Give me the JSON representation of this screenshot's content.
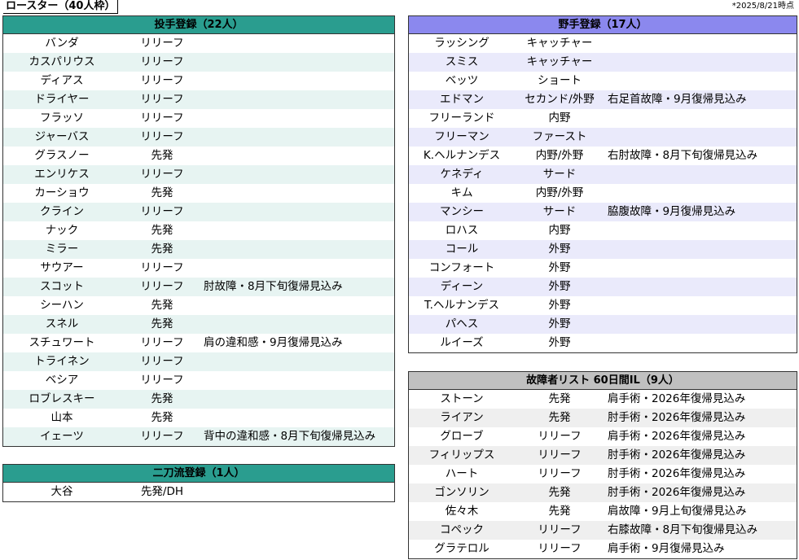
{
  "title": "ロースター（40人枠）",
  "datestamp": "*2025/8/21時点",
  "pitchers": {
    "header": "投手登録（22人）",
    "rows": [
      {
        "name": "バンダ",
        "pos": "リリーフ",
        "note": ""
      },
      {
        "name": "カスパリウス",
        "pos": "リリーフ",
        "note": ""
      },
      {
        "name": "ディアス",
        "pos": "リリーフ",
        "note": ""
      },
      {
        "name": "ドライヤー",
        "pos": "リリーフ",
        "note": ""
      },
      {
        "name": "フラッソ",
        "pos": "リリーフ",
        "note": ""
      },
      {
        "name": "ジャーバス",
        "pos": "リリーフ",
        "note": ""
      },
      {
        "name": "グラスノー",
        "pos": "先発",
        "note": ""
      },
      {
        "name": "エンリケス",
        "pos": "リリーフ",
        "note": ""
      },
      {
        "name": "カーショウ",
        "pos": "先発",
        "note": ""
      },
      {
        "name": "クライン",
        "pos": "リリーフ",
        "note": ""
      },
      {
        "name": "ナック",
        "pos": "先発",
        "note": ""
      },
      {
        "name": "ミラー",
        "pos": "先発",
        "note": ""
      },
      {
        "name": "サウアー",
        "pos": "リリーフ",
        "note": ""
      },
      {
        "name": "スコット",
        "pos": "リリーフ",
        "note": "肘故障・8月下旬復帰見込み"
      },
      {
        "name": "シーハン",
        "pos": "先発",
        "note": ""
      },
      {
        "name": "スネル",
        "pos": "先発",
        "note": ""
      },
      {
        "name": "スチュワート",
        "pos": "リリーフ",
        "note": "肩の違和感・9月復帰見込み"
      },
      {
        "name": "トライネン",
        "pos": "リリーフ",
        "note": ""
      },
      {
        "name": "ベシア",
        "pos": "リリーフ",
        "note": ""
      },
      {
        "name": "ロブレスキー",
        "pos": "先発",
        "note": ""
      },
      {
        "name": "山本",
        "pos": "先発",
        "note": ""
      },
      {
        "name": "イェーツ",
        "pos": "リリーフ",
        "note": "背中の違和感・8月下旬復帰見込み"
      }
    ]
  },
  "twoway": {
    "header": "二刀流登録（1人）",
    "rows": [
      {
        "name": "大谷",
        "pos": "先発/DH",
        "note": ""
      }
    ]
  },
  "fielders": {
    "header": "野手登録（17人）",
    "rows": [
      {
        "name": "ラッシング",
        "pos": "キャッチャー",
        "note": ""
      },
      {
        "name": "スミス",
        "pos": "キャッチャー",
        "note": ""
      },
      {
        "name": "ベッツ",
        "pos": "ショート",
        "note": ""
      },
      {
        "name": "エドマン",
        "pos": "セカンド/外野",
        "note": "右足首故障・9月復帰見込み"
      },
      {
        "name": "フリーランド",
        "pos": "内野",
        "note": ""
      },
      {
        "name": "フリーマン",
        "pos": "ファースト",
        "note": ""
      },
      {
        "name": "K.ヘルナンデス",
        "pos": "内野/外野",
        "note": "右肘故障・8月下旬復帰見込み"
      },
      {
        "name": "ケネディ",
        "pos": "サード",
        "note": ""
      },
      {
        "name": "キム",
        "pos": "内野/外野",
        "note": ""
      },
      {
        "name": "マンシー",
        "pos": "サード",
        "note": "脇腹故障・9月復帰見込み"
      },
      {
        "name": "ロハス",
        "pos": "内野",
        "note": ""
      },
      {
        "name": "コール",
        "pos": "外野",
        "note": ""
      },
      {
        "name": "コンフォート",
        "pos": "外野",
        "note": ""
      },
      {
        "name": "ディーン",
        "pos": "外野",
        "note": ""
      },
      {
        "name": "T.ヘルナンデス",
        "pos": "外野",
        "note": ""
      },
      {
        "name": "パヘス",
        "pos": "外野",
        "note": ""
      },
      {
        "name": "ルイーズ",
        "pos": "外野",
        "note": ""
      }
    ]
  },
  "injured": {
    "header": "故障者リスト 60日間IL（9人）",
    "rows": [
      {
        "name": "ストーン",
        "pos": "先発",
        "note": "肩手術・2026年復帰見込み"
      },
      {
        "name": "ライアン",
        "pos": "先発",
        "note": "肘手術・2026年復帰見込み"
      },
      {
        "name": "グローブ",
        "pos": "リリーフ",
        "note": "肩手術・2026年復帰見込み"
      },
      {
        "name": "フィリップス",
        "pos": "リリーフ",
        "note": "肘手術・2026年復帰見込み"
      },
      {
        "name": "ハート",
        "pos": "リリーフ",
        "note": "肘手術・2026年復帰見込み"
      },
      {
        "name": "ゴンソリン",
        "pos": "先発",
        "note": "肘手術・2026年復帰見込み"
      },
      {
        "name": "佐々木",
        "pos": "先発",
        "note": "肩故障・9月上旬復帰見込み"
      },
      {
        "name": "コペック",
        "pos": "リリーフ",
        "note": "右膝故障・8月下旬復帰見込み"
      },
      {
        "name": "グラテロル",
        "pos": "リリーフ",
        "note": "肩手術・9月復帰見込み"
      }
    ]
  },
  "colors": {
    "pitcher_header": "#2a9d8f",
    "fielder_header": "#8b88ee",
    "injured_header": "#c0c0c0"
  }
}
